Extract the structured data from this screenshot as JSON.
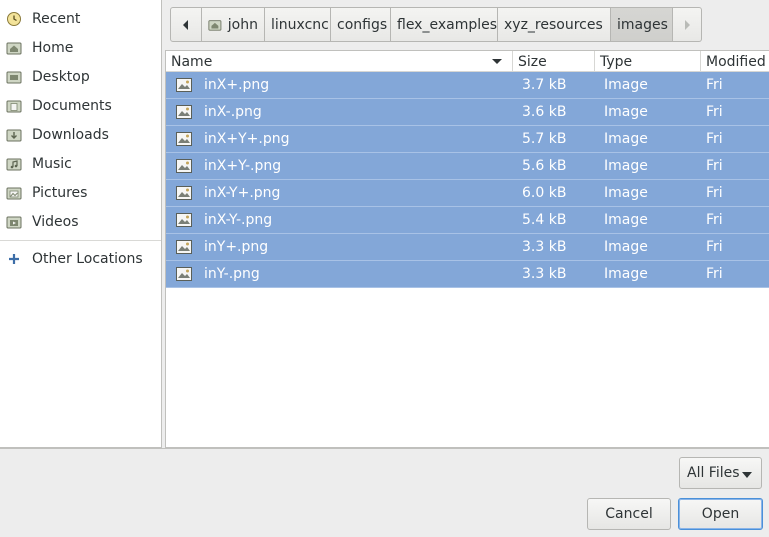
{
  "sidebar": {
    "items": [
      {
        "label": "Recent",
        "icon": "recent-icon"
      },
      {
        "label": "Home",
        "icon": "home-folder-icon"
      },
      {
        "label": "Desktop",
        "icon": "desktop-folder-icon"
      },
      {
        "label": "Documents",
        "icon": "documents-folder-icon"
      },
      {
        "label": "Downloads",
        "icon": "downloads-folder-icon"
      },
      {
        "label": "Music",
        "icon": "music-folder-icon"
      },
      {
        "label": "Pictures",
        "icon": "pictures-folder-icon"
      },
      {
        "label": "Videos",
        "icon": "videos-folder-icon"
      }
    ],
    "other_locations": {
      "label": "Other Locations",
      "icon": "plus-icon"
    }
  },
  "pathbar": {
    "crumbs": [
      "john",
      "linuxcnc",
      "configs",
      "flex_examples",
      "xyz_resources",
      "images"
    ],
    "active": "images"
  },
  "filelist": {
    "columns": {
      "name": "Name",
      "size": "Size",
      "type": "Type",
      "modified": "Modified"
    },
    "rows": [
      {
        "name": "inX+.png",
        "size": "3.7 kB",
        "type": "Image",
        "modified": "Fri"
      },
      {
        "name": "inX-.png",
        "size": "3.6 kB",
        "type": "Image",
        "modified": "Fri"
      },
      {
        "name": "inX+Y+.png",
        "size": "5.7 kB",
        "type": "Image",
        "modified": "Fri"
      },
      {
        "name": "inX+Y-.png",
        "size": "5.6 kB",
        "type": "Image",
        "modified": "Fri"
      },
      {
        "name": "inX-Y+.png",
        "size": "6.0 kB",
        "type": "Image",
        "modified": "Fri"
      },
      {
        "name": "inX-Y-.png",
        "size": "5.4 kB",
        "type": "Image",
        "modified": "Fri"
      },
      {
        "name": "inY+.png",
        "size": "3.3 kB",
        "type": "Image",
        "modified": "Fri"
      },
      {
        "name": "inY-.png",
        "size": "3.3 kB",
        "type": "Image",
        "modified": "Fri"
      }
    ]
  },
  "filter": {
    "selected": "All Files"
  },
  "buttons": {
    "cancel": "Cancel",
    "open": "Open"
  },
  "colors": {
    "selection": "#83a7d8",
    "accent": "#4a90d9"
  }
}
